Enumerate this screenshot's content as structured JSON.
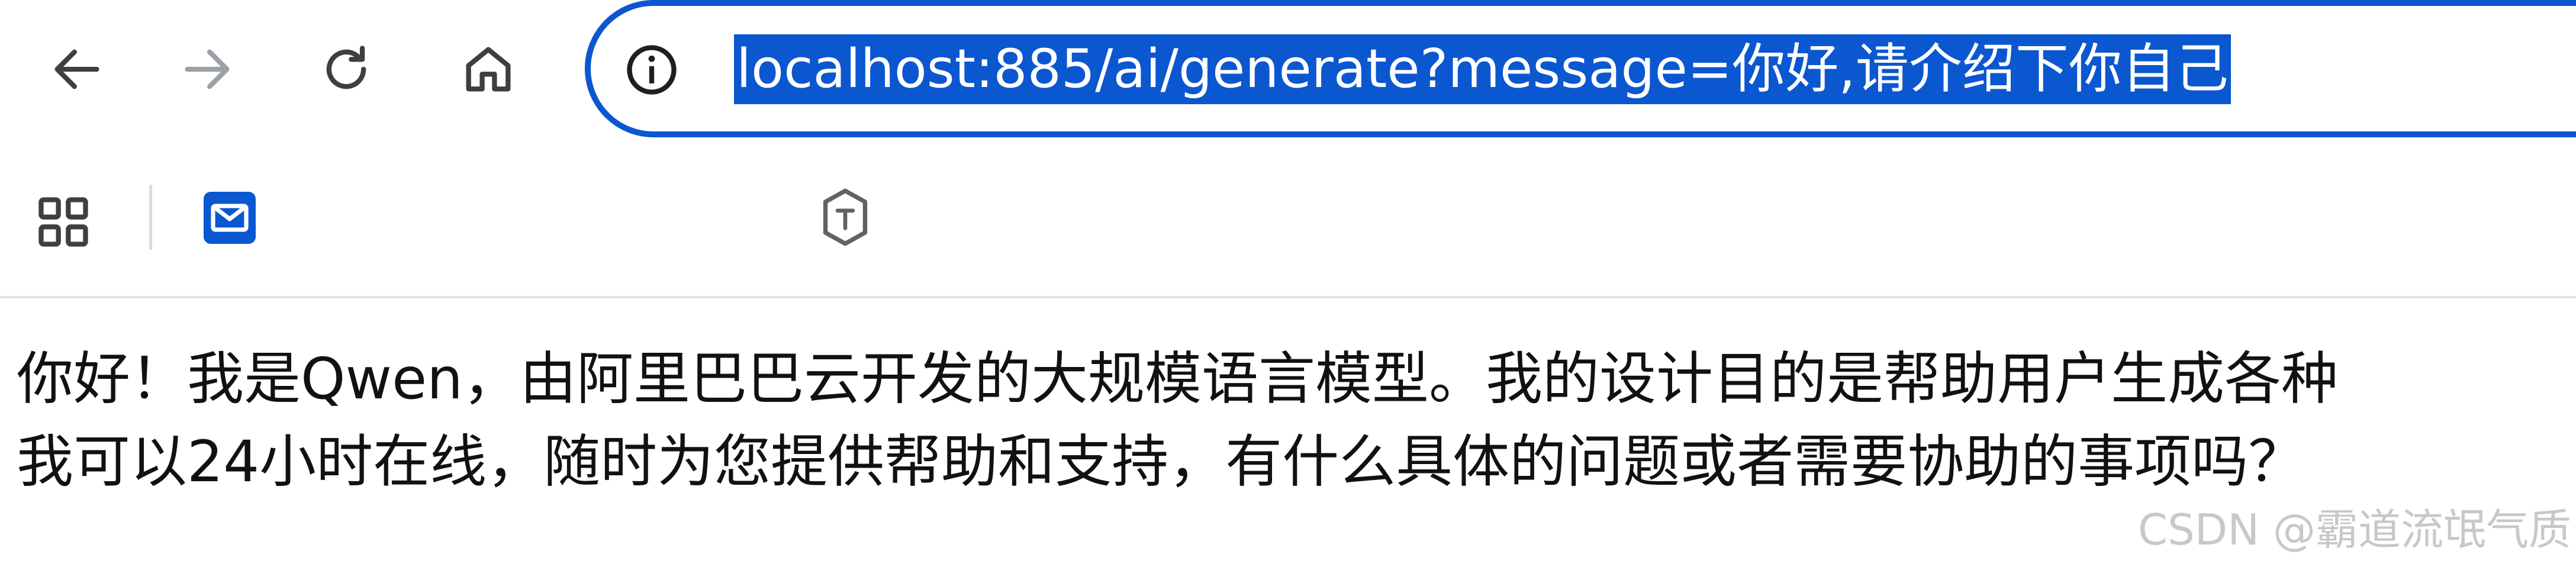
{
  "navbar": {
    "back_icon": "arrow-left-icon",
    "forward_icon": "arrow-right-icon",
    "reload_icon": "reload-icon",
    "home_icon": "home-icon",
    "site_info_icon": "info-icon",
    "url": "localhost:885/ai/generate?message=你好,请介绍下你自己"
  },
  "bookmarks": {
    "apps_icon": "apps-grid-icon",
    "mail_icon": "mail-icon",
    "extension_icon": "shield-extension-icon"
  },
  "page": {
    "line1": "你好！我是Qwen，由阿里巴巴云开发的大规模语言模型。我的设计目的是帮助用户生成各种",
    "line2": "我可以24小时在线，随时为您提供帮助和支持，有什么具体的问题或者需要协助的事项吗？"
  },
  "watermark": "CSDN @霸道流氓气质",
  "colors": {
    "accent": "#0b57d0",
    "icon": "#3c4043",
    "icon_disabled": "#9aa0a6"
  }
}
